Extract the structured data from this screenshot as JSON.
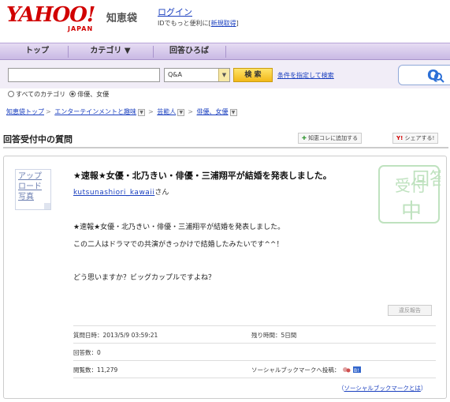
{
  "header": {
    "logo_text": "YAHOO!",
    "logo_sub": "JAPAN",
    "service_name": "知恵袋",
    "login_label": "ログイン",
    "login_sub_prefix": "IDでもっと便利に[",
    "register_label": "新規取得",
    "login_sub_suffix": "]"
  },
  "nav": {
    "items": [
      {
        "label": "トップ"
      },
      {
        "label": "カテゴリ ▼"
      },
      {
        "label": "回答ひろば"
      }
    ]
  },
  "search": {
    "input_value": "",
    "select_value": "Q&A",
    "button_label": "検 索",
    "advanced_label": "条件を指定して検索",
    "q_label": "Q"
  },
  "scope": {
    "all_label": "すべてのカテゴリ",
    "current_label": "俳優、女優"
  },
  "breadcrumb": [
    {
      "label": "知恵袋トップ"
    },
    {
      "label": "エンターテインメントと趣味"
    },
    {
      "label": "芸能人"
    },
    {
      "label": "俳優、女優"
    }
  ],
  "section": {
    "title": "回答受付中の質問",
    "add_label": "知恵コレに追加する",
    "share_label": "シェアする!",
    "share_icon_text": "Y!"
  },
  "question": {
    "avatar_text": [
      "アップ",
      "ロード",
      "写真"
    ],
    "title": "★速報★女優・北乃きい・俳優・三浦翔平が結婚を発表しました。",
    "asker_name": "kutsunashiori_kawaii",
    "asker_suffix": "さん",
    "stamp_text": [
      "受付",
      "回答",
      "中"
    ],
    "body": [
      "★速報★女優・北乃きい・俳優・三浦翔平が結婚を発表しました。",
      "この二人はドラマでの共演がきっかけで結婚したみたいです^^！",
      "",
      "どう思いますか？ビッグカップルですよね？"
    ],
    "small_button_label": "違反報告",
    "meta": {
      "posted": "質問日時：2013/5/9 03:59:21",
      "remaining": "残り時間：5日間",
      "answers": "回答数：0",
      "views": "閲覧数：11,279",
      "bookmark_label": "ソーシャルブックマークへ投稿：",
      "bookmark_link": "ソーシャルブックマークとは",
      "bookmark_link_prefix": "（",
      "bookmark_link_suffix": "）"
    }
  },
  "colors": {
    "brand_red": "#d10000",
    "nav_purple": "#c9b9e4",
    "link_blue": "#1a3fbf",
    "stamp_green": "#a8d6a8"
  }
}
